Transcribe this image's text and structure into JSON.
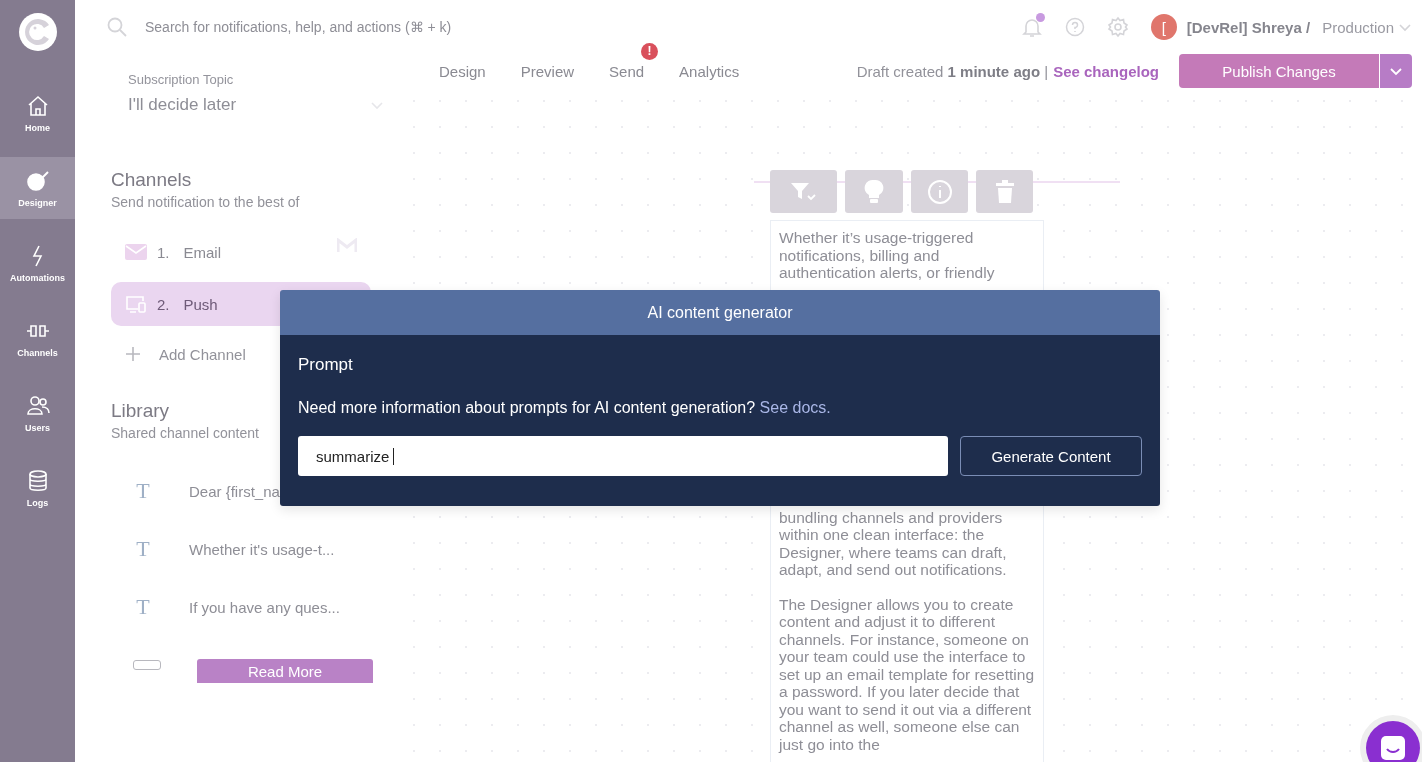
{
  "sidebar": {
    "items": [
      {
        "kind": "home",
        "label": "Home",
        "selected": false
      },
      {
        "kind": "designer",
        "label": "Designer",
        "selected": true
      },
      {
        "kind": "automations",
        "label": "Automations",
        "selected": false
      },
      {
        "kind": "channels",
        "label": "Channels",
        "selected": false
      },
      {
        "kind": "users",
        "label": "Users",
        "selected": false
      },
      {
        "kind": "logs",
        "label": "Logs",
        "selected": false
      }
    ]
  },
  "top_bar": {
    "search": {
      "placeholder": "Search for notifications, help, and actions (⌘ + k)"
    },
    "notifications_unread": true,
    "avatar_initial": "[",
    "workspace": "[DevRel] Shreya /",
    "environment": "Production"
  },
  "subscription_topic": {
    "label": "Subscription Topic",
    "value": "I'll decide later"
  },
  "tabs": [
    {
      "label": "Design"
    },
    {
      "label": "Preview"
    },
    {
      "label": "Send",
      "badge": "!"
    },
    {
      "label": "Analytics"
    }
  ],
  "draft_status": "Draft created **1 minute ago** |",
  "changelog_link": "See changelog",
  "publish_button": "Publish Changes",
  "channels": {
    "title": "Channels",
    "subtitle": "Send notification to the best of",
    "items": [
      {
        "kind": "email",
        "number": "1.",
        "name": "Email",
        "selected": false
      },
      {
        "kind": "push",
        "number": "2.",
        "name": "Push",
        "selected": true
      }
    ],
    "add_label": "Add Channel"
  },
  "library": {
    "title": "Library",
    "subtitle": "Shared channel content",
    "items": [
      {
        "kind": "text",
        "icon": "T",
        "preview": "Dear {first_na"
      },
      {
        "kind": "text",
        "icon": "T",
        "preview": "Whether it's usage-t..."
      },
      {
        "kind": "text",
        "icon": "T",
        "preview": "If you have any ques..."
      },
      {
        "kind": "button",
        "label": "Read More"
      }
    ]
  },
  "editor": {
    "content": [
      "Whether it’s usage-triggered notifications, billing and authentication alerts, or friendly",
      "bundling channels and providers within one clean interface: the Designer, where teams can draft, adapt, and send out notifications.",
      "The Designer allows you to create content and adjust it to different channels. For instance, someone on your team could use the interface to set up an email template for resetting a password. If you later decide that you want to send it out via a different channel as well, someone else can just go into the"
    ]
  },
  "modal": {
    "title": "AI content generator",
    "label": "Prompt",
    "help": "Need more information about prompts for AI content generation?",
    "help_link": "See docs.",
    "prompt": {
      "value": "summarize"
    },
    "generate_button": "Generate Content"
  }
}
